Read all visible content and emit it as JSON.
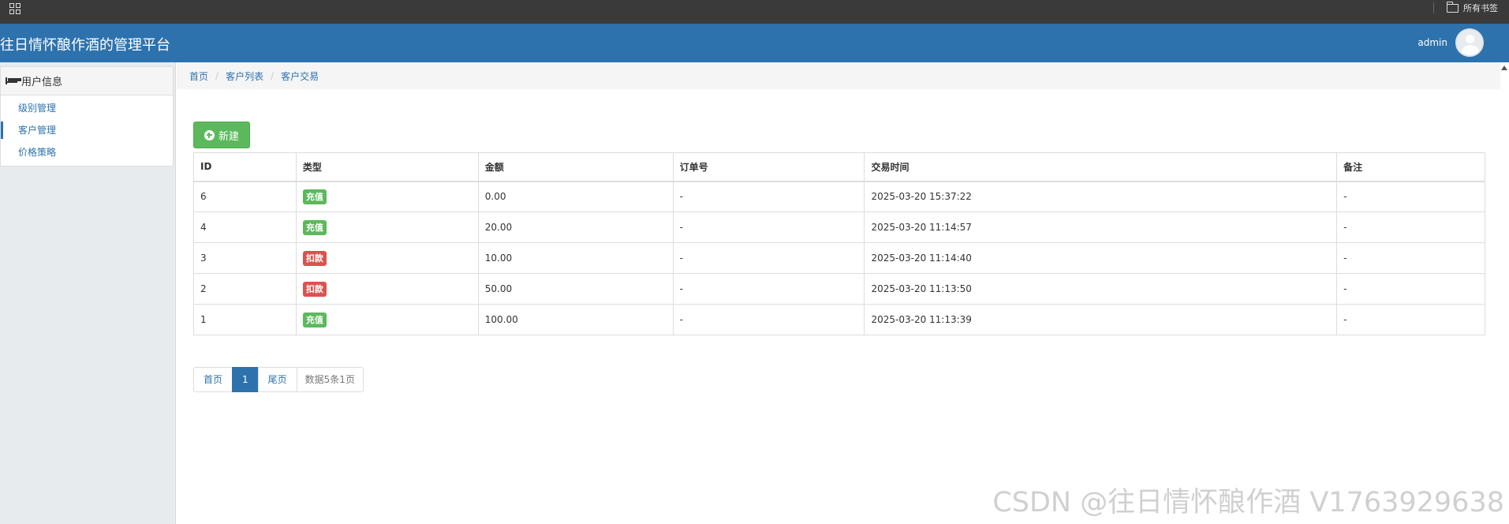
{
  "browser": {
    "bookmarks_folder_label": "所有书签"
  },
  "header": {
    "title": "往日情怀酿作酒的管理平台",
    "username": "admin"
  },
  "sidebar": {
    "section_title": "用户信息",
    "items": [
      {
        "label": "级别管理"
      },
      {
        "label": "客户管理"
      },
      {
        "label": "价格策略"
      }
    ],
    "active_item": "客户管理"
  },
  "breadcrumb": [
    "首页",
    "客户列表",
    "客户交易"
  ],
  "toolbar": {
    "new_label": "新建"
  },
  "table": {
    "columns": [
      "ID",
      "类型",
      "金额",
      "订单号",
      "交易时间",
      "备注"
    ],
    "rows": [
      {
        "id": "6",
        "type": "充值",
        "type_kind": "success",
        "amount": "0.00",
        "order_no": "-",
        "time": "2025-03-20 15:37:22",
        "note": "-"
      },
      {
        "id": "4",
        "type": "充值",
        "type_kind": "success",
        "amount": "20.00",
        "order_no": "-",
        "time": "2025-03-20 11:14:57",
        "note": "-"
      },
      {
        "id": "3",
        "type": "扣款",
        "type_kind": "danger",
        "amount": "10.00",
        "order_no": "-",
        "time": "2025-03-20 11:14:40",
        "note": "-"
      },
      {
        "id": "2",
        "type": "扣款",
        "type_kind": "danger",
        "amount": "50.00",
        "order_no": "-",
        "time": "2025-03-20 11:13:50",
        "note": "-"
      },
      {
        "id": "1",
        "type": "充值",
        "type_kind": "success",
        "amount": "100.00",
        "order_no": "-",
        "time": "2025-03-20 11:13:39",
        "note": "-"
      }
    ]
  },
  "pagination": {
    "first_label": "首页",
    "current_page": "1",
    "last_label": "尾页",
    "summary": "数据5条1页"
  },
  "watermark": "CSDN @往日情怀酿作酒 V1763929638",
  "colors": {
    "header_bg": "#2d72ad",
    "success": "#5cb85c",
    "danger": "#d9534f",
    "link": "#2d72ad"
  },
  "icons": {
    "apps": "apps-grid-icon",
    "folder": "folder-icon",
    "section": "bed-icon",
    "new": "plus-circle-icon",
    "avatar": "user-avatar"
  }
}
